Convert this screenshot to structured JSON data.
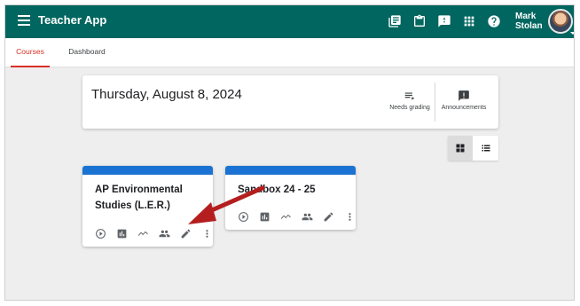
{
  "app": {
    "title": "Teacher App"
  },
  "header": {
    "icons": [
      "library-books-icon",
      "clipboard-icon",
      "feedback-icon",
      "apps-icon",
      "help-icon"
    ],
    "user_first": "Mark",
    "user_last": "Stolan"
  },
  "tabs": [
    {
      "label": "Courses",
      "active": true
    },
    {
      "label": "Dashboard",
      "active": false
    }
  ],
  "date_card": {
    "date": "Thursday, August 8, 2024",
    "actions": [
      {
        "label": "Needs grading",
        "icon": "needs-grading-icon"
      },
      {
        "label": "Announcements",
        "icon": "announcement-icon"
      }
    ]
  },
  "view_toggle": {
    "selected": "grid"
  },
  "courses": [
    {
      "title": "AP Environmental Studies (L.E.R.)",
      "bar_color": "#1a73d2",
      "icons": [
        "play-icon",
        "bar-chart-icon",
        "trend-icon",
        "people-icon",
        "pencil-icon",
        "more-vert-icon"
      ]
    },
    {
      "title": "Sandbox 24 - 25",
      "bar_color": "#1a73d2",
      "icons": [
        "play-icon",
        "bar-chart-icon",
        "trend-icon",
        "people-icon",
        "pencil-icon",
        "more-vert-icon"
      ]
    }
  ],
  "colors": {
    "appbar": "#00665f",
    "accent": "#d93025",
    "course_bar": "#1a73d2",
    "annotation_arrow": "#b51e1e"
  }
}
